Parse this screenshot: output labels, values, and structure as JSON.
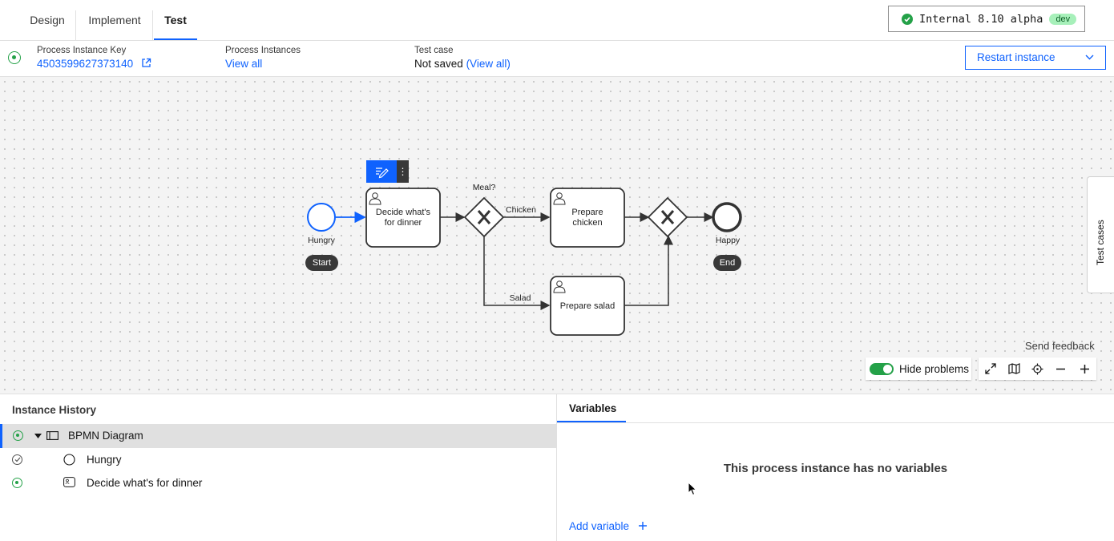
{
  "tabs": [
    {
      "label": "Design"
    },
    {
      "label": "Implement"
    },
    {
      "label": "Test",
      "active": true
    }
  ],
  "environment": {
    "name": "Internal 8.10 alpha",
    "tag": "dev",
    "status_color": "#24a148"
  },
  "info": {
    "instance_key_label": "Process Instance Key",
    "instance_key_value": "4503599627373140",
    "instances_label": "Process Instances",
    "instances_link": "View all",
    "test_case_label": "Test case",
    "test_case_status": "Not saved",
    "test_case_link": "(View all)",
    "restart_button": "Restart instance"
  },
  "diagram": {
    "start_event": "Hungry",
    "start_badge": "Start",
    "task_decide": [
      "Decide what's",
      "for dinner"
    ],
    "gateway_label": "Meal?",
    "flow_chicken": "Chicken",
    "flow_salad": "Salad",
    "task_chicken": [
      "Prepare",
      "chicken"
    ],
    "task_salad": "Prepare salad",
    "end_event": "Happy",
    "end_badge": "End",
    "accent_color": "#0f62fe"
  },
  "side_tab": "Test cases",
  "canvas_controls": {
    "send_feedback": "Send feedback",
    "hide_problems": "Hide problems",
    "hide_problems_enabled": true,
    "tools": [
      "fullscreen-icon",
      "minimap-icon",
      "recenter-icon",
      "zoom-out-icon",
      "zoom-in-icon"
    ]
  },
  "history": {
    "title": "Instance History",
    "items": [
      {
        "label": "BPMN Diagram",
        "status": "active"
      },
      {
        "label": "Hungry",
        "status": "completed"
      },
      {
        "label": "Decide what's for dinner",
        "status": "active"
      }
    ]
  },
  "variables": {
    "tab": "Variables",
    "empty_message": "This process instance has no variables",
    "add_variable": "Add variable"
  }
}
